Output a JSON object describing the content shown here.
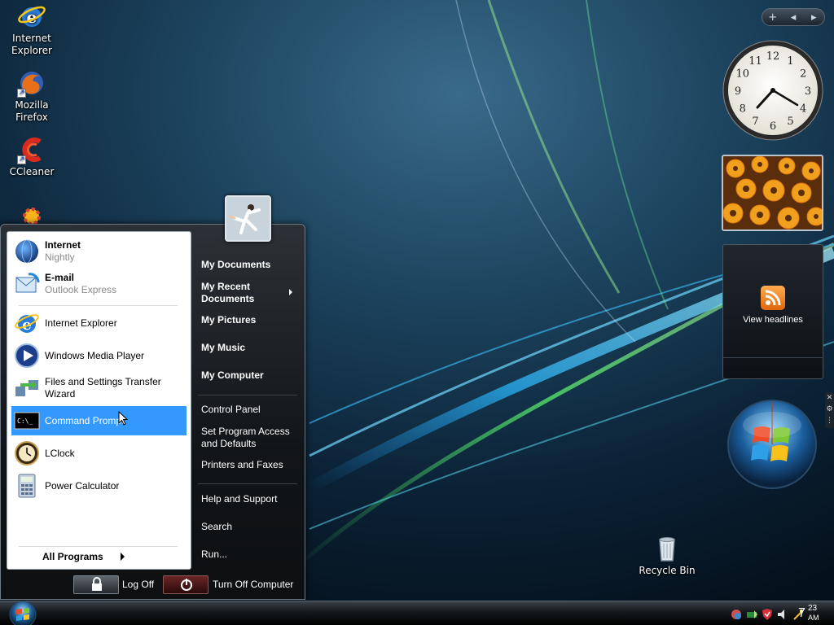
{
  "desktop_icons": [
    {
      "label_line1": "Internet",
      "label_line2": "Explorer",
      "icon": "internet-explorer-icon"
    },
    {
      "label_line1": "Mozilla",
      "label_line2": "Firefox",
      "icon": "firefox-icon"
    },
    {
      "label_line1": "CCleaner",
      "label_line2": "",
      "icon": "ccleaner-icon"
    },
    {
      "label_line1": "Recycle Bin",
      "label_line2": "",
      "icon": "recycle-bin-icon"
    }
  ],
  "gadgets": {
    "controls": {
      "add": "+",
      "prev": "◂",
      "next": "▸"
    },
    "clock_numbers": [
      "12",
      "1",
      "2",
      "3",
      "4",
      "5",
      "6",
      "7",
      "8",
      "9",
      "10",
      "11"
    ],
    "feed_label": "View headlines"
  },
  "start_menu": {
    "pinned": [
      {
        "title": "Internet",
        "subtitle": "Nightly",
        "icon": "globe-icon"
      },
      {
        "title": "E-mail",
        "subtitle": "Outlook Express",
        "icon": "outlook-express-icon"
      }
    ],
    "recent": [
      {
        "label": "Internet Explorer",
        "icon": "internet-explorer-icon"
      },
      {
        "label": "Windows Media Player",
        "icon": "media-player-icon"
      },
      {
        "label": "Files and Settings Transfer Wizard",
        "icon": "transfer-wizard-icon"
      },
      {
        "label": "Command Prompt",
        "icon": "command-prompt-icon",
        "highlighted": true
      },
      {
        "label": "LClock",
        "icon": "lclock-icon"
      },
      {
        "label": "Power Calculator",
        "icon": "calculator-icon"
      }
    ],
    "all_programs": "All Programs",
    "right_column": {
      "my_documents": "My Documents",
      "my_recent_documents_1": "My Recent",
      "my_recent_documents_2": "Documents",
      "my_pictures": "My Pictures",
      "my_music": "My Music",
      "my_computer": "My Computer",
      "control_panel": "Control Panel",
      "set_program_access_1": "Set Program Access",
      "set_program_access_2": "and Defaults",
      "printers_and_faxes": "Printers and Faxes",
      "help_and_support": "Help and Support",
      "search": "Search",
      "run": "Run..."
    },
    "log_off": "Log Off",
    "turn_off": "Turn Off Computer"
  },
  "taskbar": {
    "clock_hour": "7",
    "clock_minute": "23",
    "clock_ampm": "AM"
  }
}
